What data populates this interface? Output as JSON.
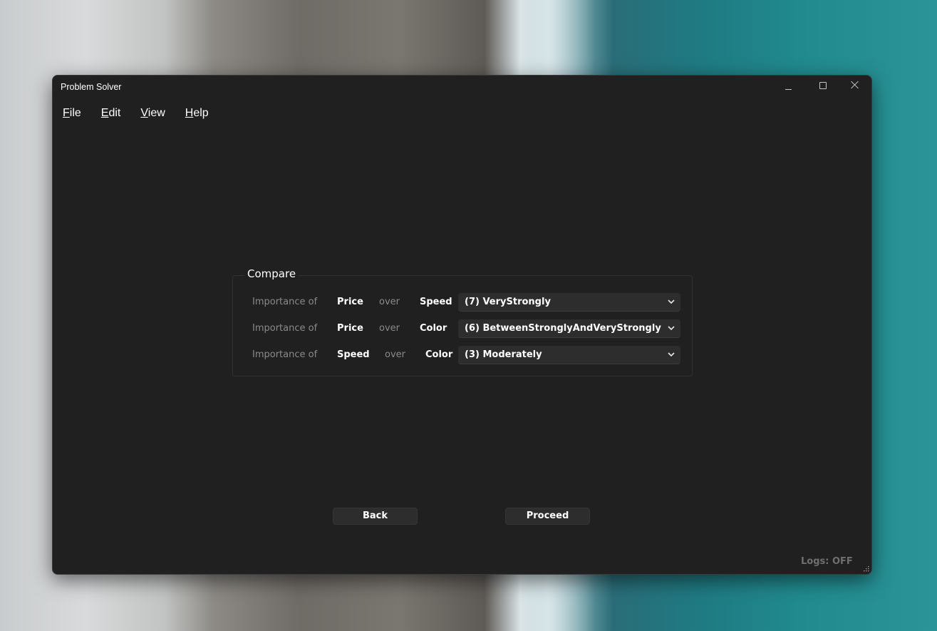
{
  "window": {
    "title": "Problem Solver"
  },
  "menu": [
    {
      "accel": "F",
      "rest": "ile"
    },
    {
      "accel": "E",
      "rest": "dit"
    },
    {
      "accel": "V",
      "rest": "iew"
    },
    {
      "accel": "H",
      "rest": "elp"
    }
  ],
  "compare": {
    "title": "Compare",
    "rows": [
      {
        "prefix": "Importance of",
        "a": "Price",
        "over": "over",
        "b": "Speed",
        "selected": "(7) VeryStrongly"
      },
      {
        "prefix": "Importance of",
        "a": "Price",
        "over": "over",
        "b": "Color",
        "selected": "(6) BetweenStronglyAndVeryStrongly"
      },
      {
        "prefix": "Importance of",
        "a": "Speed",
        "over": "over",
        "b": "Color",
        "selected": "(3) Moderately"
      }
    ]
  },
  "buttons": {
    "back": "Back",
    "proceed": "Proceed"
  },
  "status": {
    "logs": "Logs: OFF"
  },
  "icons": {
    "minimize": "minimize-icon",
    "maximize": "maximize-icon",
    "close": "close-icon",
    "dropdown": "chevron-down-icon",
    "resize": "resize-grip-icon"
  },
  "colors": {
    "window_bg": "#202020",
    "control_bg": "#2d2d2d",
    "muted_text": "#8a8a8a",
    "status_text": "#6f6f6f"
  }
}
